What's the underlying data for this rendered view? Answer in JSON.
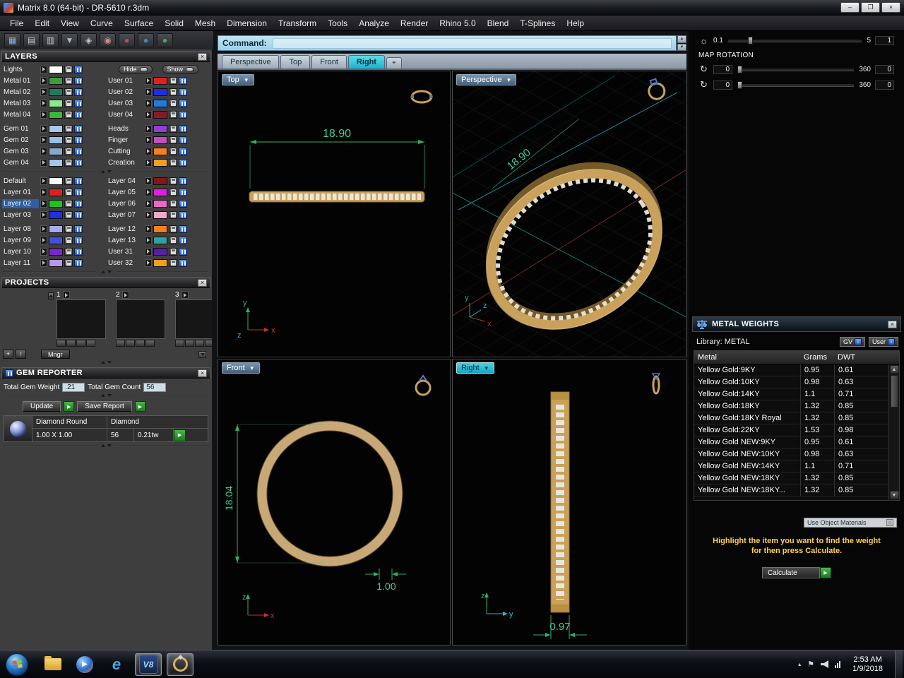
{
  "window": {
    "title": "Matrix 8.0 (64-bit) - DR-5610 r.3dm",
    "minimize": "–",
    "restore": "❐",
    "close": "×"
  },
  "menu": {
    "items": [
      "File",
      "Edit",
      "View",
      "Curve",
      "Surface",
      "Solid",
      "Mesh",
      "Dimension",
      "Transform",
      "Tools",
      "Analyze",
      "Render",
      "Rhino 5.0",
      "Blend",
      "T-Splines",
      "Help"
    ]
  },
  "toolbar": {
    "icons": [
      {
        "name": "viewport-layout-icon",
        "glyph": "▦",
        "color": "#8ab4e8"
      },
      {
        "name": "panel-toggle-icon",
        "glyph": "▤",
        "color": "#c8c8c8"
      },
      {
        "name": "display-mode-icon",
        "glyph": "▥",
        "color": "#c8c8c8"
      },
      {
        "name": "selection-filter-icon",
        "glyph": "▼",
        "color": "#b0b8c0"
      },
      {
        "name": "snap-icon",
        "glyph": "◈",
        "color": "#c8c8c8"
      },
      {
        "name": "history-icon",
        "glyph": "◉",
        "color": "#d09090"
      },
      {
        "name": "render-icon",
        "glyph": "●",
        "color": "#d04848"
      },
      {
        "name": "material-icon",
        "glyph": "●",
        "color": "#4888d8"
      },
      {
        "name": "gem-studio-icon",
        "glyph": "●",
        "color": "#48b068"
      }
    ]
  },
  "command": {
    "label": "Command:"
  },
  "tabs": {
    "items": [
      "Perspective",
      "Top",
      "Front",
      "Right"
    ],
    "add": "+"
  },
  "viewports": {
    "top": {
      "label": "Top",
      "dim": "18.90",
      "axis_up": "y",
      "axis_right": "x",
      "axis_origin": "z"
    },
    "perspective": {
      "label": "Perspective",
      "dim": "18.90",
      "axis_up": "y",
      "axis_mid": "z",
      "axis_right": "x"
    },
    "front": {
      "label": "Front",
      "dim_vertical": "18.04",
      "dim_bottom": "1.00",
      "axis_up": "z",
      "axis_right": "x"
    },
    "right": {
      "label": "Right",
      "dim_bottom": "0.97",
      "axis_up": "z",
      "axis_right": "y"
    }
  },
  "layers": {
    "title": "LAYERS",
    "lights_label": "Lights",
    "lights_color": "#ffffff",
    "hide_label": "Hide",
    "show_label": "Show",
    "group1": [
      {
        "l": "Metal 01",
        "lc": "#3a9e3a",
        "r": "User 01",
        "rc": "#e02020"
      },
      {
        "l": "Metal 02",
        "lc": "#1e7a62",
        "r": "User 02",
        "rc": "#2030e0"
      },
      {
        "l": "Metal 03",
        "lc": "#8ae88a",
        "r": "User 03",
        "rc": "#2878d8"
      },
      {
        "l": "Metal 04",
        "lc": "#38b838",
        "r": "User 04",
        "rc": "#8a1a2a"
      }
    ],
    "group2": [
      {
        "l": "Gem 01",
        "lc": "#a8c8e8",
        "r": "Heads",
        "rc": "#9040d0"
      },
      {
        "l": "Gem 02",
        "lc": "#98c0e8",
        "r": "Finger",
        "rc": "#c050c0"
      },
      {
        "l": "Gem 03",
        "lc": "#88a8c8",
        "r": "Cutting",
        "rc": "#f08020"
      },
      {
        "l": "Gem 04",
        "lc": "#a0c8f0",
        "r": "Creation",
        "rc": "#f0a020"
      }
    ],
    "group3": [
      {
        "l": "Default",
        "lc": "#ffffff",
        "r": "Layer 04",
        "rc": "#801818"
      },
      {
        "l": "Layer 01",
        "lc": "#e02020",
        "r": "Layer 05",
        "rc": "#e020e0"
      },
      {
        "l": "Layer 02",
        "lc": "#20c020",
        "r": "Layer 06",
        "rc": "#e868c8",
        "lbg": "#2f5f9f"
      },
      {
        "l": "Layer 03",
        "lc": "#2030e0",
        "r": "Layer 07",
        "rc": "#f0a8c8"
      }
    ],
    "group4": [
      {
        "l": "Layer 08",
        "lc": "#a8a8f0",
        "r": "Layer 12",
        "rc": "#f08020"
      },
      {
        "l": "Layer 09",
        "lc": "#4050e0",
        "r": "Layer 13",
        "rc": "#30a0a0"
      },
      {
        "l": "Layer 10",
        "lc": "#7828c8",
        "r": "User 31",
        "rc": "#5820a0"
      },
      {
        "l": "Layer 11",
        "lc": "#b898e8",
        "r": "User 32",
        "rc": "#f0a020"
      }
    ]
  },
  "projects": {
    "title": "PROJECTS",
    "slots": [
      {
        "num": "1"
      },
      {
        "num": "2"
      },
      {
        "num": "3"
      }
    ],
    "add": "+",
    "up": "↑",
    "mngr": "Mngr"
  },
  "gem_reporter": {
    "title": "GEM REPORTER",
    "weight_label": "Total Gem Weight",
    "weight_value": ".21",
    "count_label": "Total Gem Count",
    "count_value": "56",
    "update": "Update",
    "save": "Save Report",
    "gem_type": "Diamond Round",
    "gem_name": "Diamond",
    "gem_size": "1.00 X 1.00",
    "gem_count": "56",
    "gem_weight": "0.21tw"
  },
  "texture": {
    "v1": "0.1",
    "v2": "5",
    "v3": "1",
    "map_rotation": "MAP ROTATION",
    "rows": [
      {
        "val": "0",
        "max": "360",
        "val2": "0"
      },
      {
        "val": "0",
        "max": "360",
        "val2": "0"
      }
    ]
  },
  "metal_weights": {
    "title": "METAL WEIGHTS",
    "library": "Library: METAL",
    "gv": "GV",
    "user": "User",
    "columns": [
      "Metal",
      "Grams",
      "DWT"
    ],
    "rows": [
      [
        "Yellow Gold:9KY",
        "0.95",
        "0.61"
      ],
      [
        "Yellow Gold:10KY",
        "0.98",
        "0.63"
      ],
      [
        "Yellow Gold:14KY",
        "1.1",
        "0.71"
      ],
      [
        "Yellow Gold:18KY",
        "1.32",
        "0.85"
      ],
      [
        "Yellow Gold:18KY Royal",
        "1.32",
        "0.85"
      ],
      [
        "Yellow Gold:22KY",
        "1.53",
        "0.98"
      ],
      [
        "Yellow Gold NEW:9KY",
        "0.95",
        "0.61"
      ],
      [
        "Yellow Gold NEW:10KY",
        "0.98",
        "0.63"
      ],
      [
        "Yellow Gold NEW:14KY",
        "1.1",
        "0.71"
      ],
      [
        "Yellow Gold NEW:18KY",
        "1.32",
        "0.85"
      ],
      [
        "Yellow Gold NEW:18KY...",
        "1.32",
        "0.85"
      ]
    ],
    "use_materials": "Use Object Materials",
    "hint1": "Highlight the item you want to find the weight",
    "hint2": "for then press Calculate.",
    "calculate": "Calculate"
  },
  "taskbar": {
    "time": "2:53 AM",
    "date": "1/9/2018"
  },
  "icons": {
    "up": "▴",
    "down": "▾",
    "tray_up": "▴",
    "sun": "☼",
    "rotate": "↻",
    "play": "▶"
  }
}
